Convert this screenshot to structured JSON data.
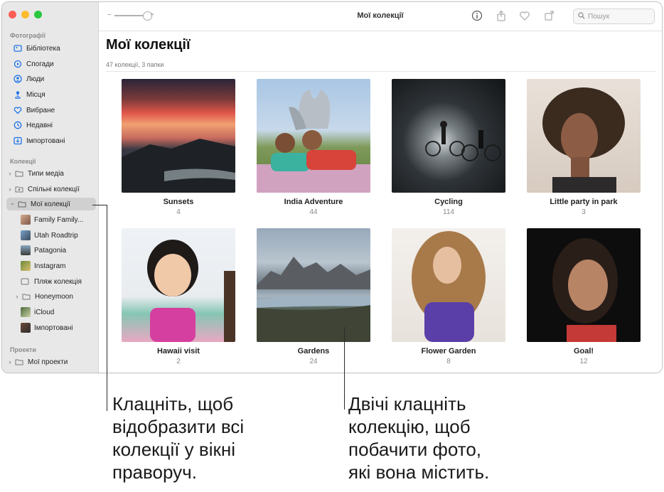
{
  "window": {
    "title": "Мої колекції",
    "search_placeholder": "Пошук",
    "zoom_minus": "−",
    "zoom_plus": "+"
  },
  "sidebar": {
    "photos_section": "Фотографії",
    "photos_items": [
      {
        "label": "Бібліотека",
        "icon": "library-icon"
      },
      {
        "label": "Спогади",
        "icon": "memories-icon"
      },
      {
        "label": "Люди",
        "icon": "people-icon"
      },
      {
        "label": "Місця",
        "icon": "places-icon"
      },
      {
        "label": "Вибране",
        "icon": "heart-icon"
      },
      {
        "label": "Недавні",
        "icon": "clock-icon"
      },
      {
        "label": "Імпортовані",
        "icon": "import-icon"
      }
    ],
    "collections_section": "Колекції",
    "collections_items": [
      {
        "label": "Типи медіа"
      },
      {
        "label": "Спільні колекції"
      },
      {
        "label": "Мої колекції"
      }
    ],
    "album_items": [
      {
        "label": "Family Family..."
      },
      {
        "label": "Utah Roadtrip"
      },
      {
        "label": "Patagonia"
      },
      {
        "label": "Instagram"
      },
      {
        "label": "Пляж колекція"
      },
      {
        "label": "Honeymoon"
      },
      {
        "label": "iCloud"
      },
      {
        "label": "Імпортовані"
      }
    ],
    "projects_section": "Проекти",
    "projects_items": [
      {
        "label": "Мої проекти"
      }
    ]
  },
  "main": {
    "heading": "Мої колекції",
    "subtitle": "47 колекції, 3 папки",
    "collections": [
      {
        "name": "Sunsets",
        "count": "4"
      },
      {
        "name": "India Adventure",
        "count": "44"
      },
      {
        "name": "Cycling",
        "count": "114"
      },
      {
        "name": "Little party in park",
        "count": "3"
      },
      {
        "name": "Hawaii visit",
        "count": "2"
      },
      {
        "name": "Gardens",
        "count": "24"
      },
      {
        "name": "Flower Garden",
        "count": "8"
      },
      {
        "name": "Goal!",
        "count": "12"
      }
    ]
  },
  "callouts": {
    "left": [
      "Клацніть, щоб",
      "відобразити всі",
      "колекції у вікні",
      "праворуч."
    ],
    "right": [
      "Двічі клацніть",
      "колекцію, щоб",
      "побачити фото,",
      "які вона містить."
    ]
  },
  "colors": {
    "accent": "#1d73e8",
    "close": "#fe5f57",
    "minimize": "#febc2e",
    "zoom": "#28c840"
  }
}
